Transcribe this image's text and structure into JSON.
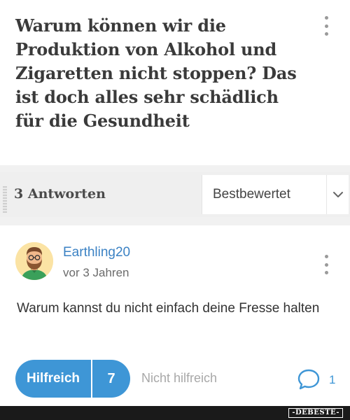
{
  "question": {
    "title": "Warum können wir die Produktion von Alkohol und Zigaretten nicht stoppen? Das ist doch alles sehr schädlich für die Gesundheit"
  },
  "answers_header": {
    "count_label": "3 Antworten",
    "sort": {
      "selected": "Bestbewertet"
    }
  },
  "answer": {
    "author": "Earthling20",
    "time": "vor 3 Jahren",
    "text": "Warum kannst du nicht einfach deine Fresse halten",
    "helpful_label": "Hilfreich",
    "helpful_count": "7",
    "not_helpful_label": "Nicht hilfreich",
    "comment_count": "1"
  },
  "watermark": {
    "text": "-DEBESTE-"
  },
  "colors": {
    "accent": "#3e96d6",
    "author_link": "#3b82c4",
    "title_text": "#3a3a3a",
    "page_background": "#f1f1f1"
  },
  "icons": {
    "question_menu": "more-vertical-icon",
    "answer_menu": "more-vertical-icon",
    "sort_toggle": "chevron-down-icon",
    "comments": "comment-bubble-icon",
    "avatar": "bearded-man-avatar"
  }
}
